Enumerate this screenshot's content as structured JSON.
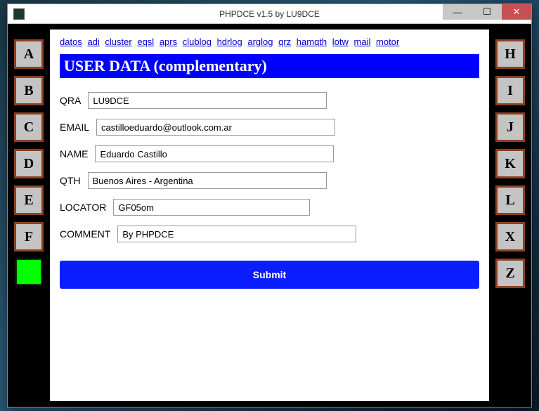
{
  "window": {
    "title": "PHPDCE v1.5 by LU9DCE"
  },
  "nav": {
    "links": [
      "datos",
      "adi",
      "cluster",
      "eqsl",
      "aprs",
      "clublog",
      "hdrlog",
      "arglog",
      "qrz",
      "hamqth",
      "lotw",
      "mail",
      "motor"
    ]
  },
  "section": {
    "title": "USER DATA (complementary)"
  },
  "sideLeft": [
    "A",
    "B",
    "C",
    "D",
    "E",
    "F"
  ],
  "sideRight": [
    "H",
    "I",
    "J",
    "K",
    "L",
    "X",
    "Z"
  ],
  "form": {
    "qra": {
      "label": "QRA",
      "value": "LU9DCE"
    },
    "email": {
      "label": "EMAIL",
      "value": "castilloeduardo@outlook.com.ar"
    },
    "name": {
      "label": "NAME",
      "value": "Eduardo Castillo"
    },
    "qth": {
      "label": "QTH",
      "value": "Buenos Aires - Argentina"
    },
    "locator": {
      "label": "LOCATOR",
      "value": "GF05om"
    },
    "comment": {
      "label": "COMMENT",
      "value": "By PHPDCE"
    },
    "submit": "Submit"
  }
}
